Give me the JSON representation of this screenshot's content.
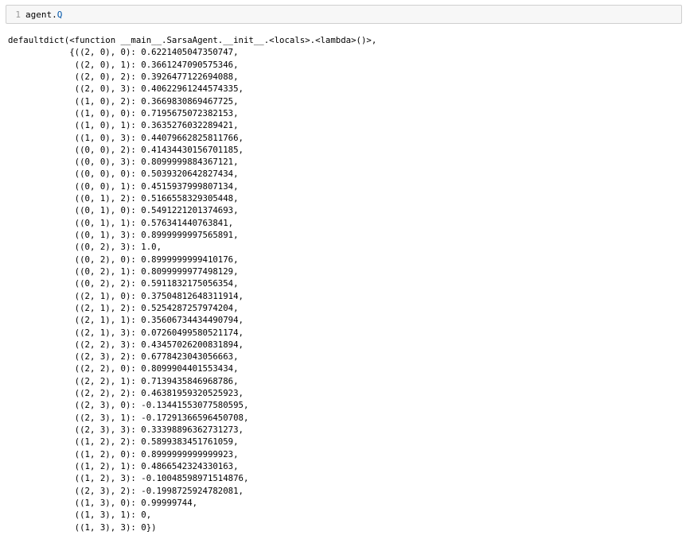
{
  "input_cell": {
    "line_number": "1",
    "code_object": "agent.",
    "code_attr": "Q"
  },
  "output": {
    "lines": [
      "defaultdict(<function __main__.SarsaAgent.__init__.<locals>.<lambda>()>,",
      "            {((2, 0), 0): 0.6221405047350747,",
      "             ((2, 0), 1): 0.3661247090575346,",
      "             ((2, 0), 2): 0.3926477122694088,",
      "             ((2, 0), 3): 0.40622961244574335,",
      "             ((1, 0), 2): 0.3669830869467725,",
      "             ((1, 0), 0): 0.7195675072382153,",
      "             ((1, 0), 1): 0.3635276032289421,",
      "             ((1, 0), 3): 0.44079662825811766,",
      "             ((0, 0), 2): 0.41434430156701185,",
      "             ((0, 0), 3): 0.8099999884367121,",
      "             ((0, 0), 0): 0.5039320642827434,",
      "             ((0, 0), 1): 0.4515937999807134,",
      "             ((0, 1), 2): 0.5166558329305448,",
      "             ((0, 1), 0): 0.5491221201374693,",
      "             ((0, 1), 1): 0.576341440763841,",
      "             ((0, 1), 3): 0.8999999997565891,",
      "             ((0, 2), 3): 1.0,",
      "             ((0, 2), 0): 0.8999999999410176,",
      "             ((0, 2), 1): 0.8099999977498129,",
      "             ((0, 2), 2): 0.5911832175056354,",
      "             ((2, 1), 0): 0.37504812648311914,",
      "             ((2, 1), 2): 0.5254287257974204,",
      "             ((2, 1), 1): 0.35606734434490794,",
      "             ((2, 1), 3): 0.07260499580521174,",
      "             ((2, 2), 3): 0.43457026200831894,",
      "             ((2, 3), 2): 0.6778423043056663,",
      "             ((2, 2), 0): 0.8099904401553434,",
      "             ((2, 2), 1): 0.7139435846968786,",
      "             ((2, 2), 2): 0.46381959320525923,",
      "             ((2, 3), 0): -0.13441553077580595,",
      "             ((2, 3), 1): -0.17291366596450708,",
      "             ((2, 3), 3): 0.33398896362731273,",
      "             ((1, 2), 2): 0.5899383451761059,",
      "             ((1, 2), 0): 0.8999999999999923,",
      "             ((1, 2), 1): 0.4866542324330163,",
      "             ((1, 2), 3): -0.10048598971514876,",
      "             ((2, 3), 2): -0.1998725924782081,",
      "             ((1, 3), 0): 0.99999744,",
      "             ((1, 3), 1): 0,",
      "             ((1, 3), 3): 0})"
    ]
  }
}
